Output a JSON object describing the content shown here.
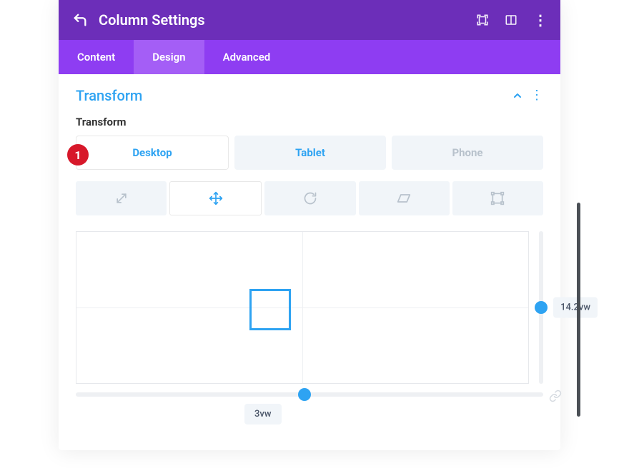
{
  "titlebar": {
    "title": "Column Settings"
  },
  "tabs": {
    "content": "Content",
    "design": "Design",
    "advanced": "Advanced",
    "active": "design"
  },
  "section": {
    "title": "Transform",
    "field_label": "Transform"
  },
  "device_tabs": {
    "desktop": "Desktop",
    "tablet": "Tablet",
    "phone": "Phone",
    "active": "desktop"
  },
  "badge": {
    "number": "1"
  },
  "transform": {
    "y_value": "14.2vw",
    "x_value": "3vw"
  }
}
